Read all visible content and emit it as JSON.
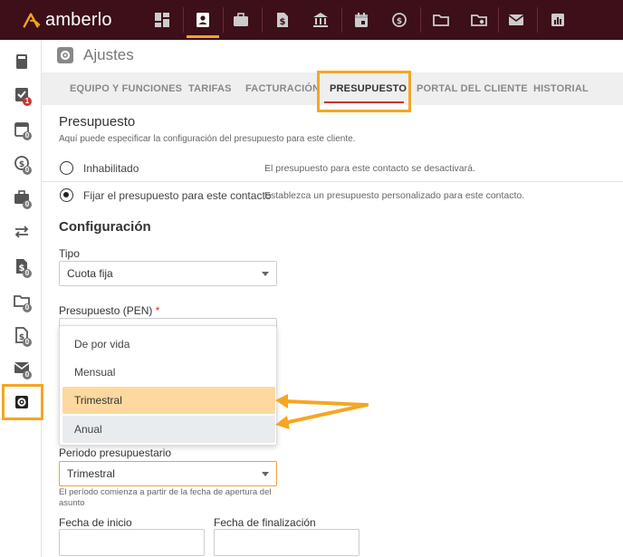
{
  "app": {
    "name": "amberlo",
    "accent": "#f5a623",
    "topbar_color": "#3d0f18"
  },
  "topnav": [
    {
      "icon": "dashboard-icon"
    },
    {
      "icon": "contact-card-icon",
      "active": true
    },
    {
      "icon": "briefcase-icon"
    },
    {
      "icon": "invoice-dollar-icon"
    },
    {
      "icon": "bank-icon"
    },
    {
      "icon": "calendar-icon"
    },
    {
      "icon": "time-money-icon"
    },
    {
      "icon": "folder-icon"
    },
    {
      "icon": "folder-settings-icon"
    },
    {
      "icon": "mail-icon"
    },
    {
      "icon": "reports-icon"
    }
  ],
  "sidebar": [
    {
      "icon": "book-icon"
    },
    {
      "icon": "task-check-icon",
      "badge": "1"
    },
    {
      "icon": "calendar-icon",
      "badge": "0"
    },
    {
      "icon": "time-money-icon",
      "badge": "0"
    },
    {
      "icon": "briefcase-icon",
      "badge": "0"
    },
    {
      "icon": "transfer-icon"
    },
    {
      "icon": "invoice-dollar-icon",
      "badge": "0"
    },
    {
      "icon": "folder-icon",
      "badge": "0"
    },
    {
      "icon": "document-money-icon",
      "badge": "0"
    },
    {
      "icon": "mail-icon",
      "badge": "0"
    },
    {
      "icon": "settings-icon",
      "active": true
    }
  ],
  "page": {
    "title": "Ajustes"
  },
  "tabs": [
    {
      "label": "EQUIPO Y FUNCIONES"
    },
    {
      "label": "TARIFAS"
    },
    {
      "label": "FACTURACIÓN"
    },
    {
      "label": "PRESUPUESTO",
      "active": true
    },
    {
      "label": "PORTAL DEL CLIENTE"
    },
    {
      "label": "HISTORIAL"
    }
  ],
  "budget": {
    "title": "Presupuesto",
    "subtitle": "Aquí puede especificar la configuración del presupuesto para este cliente.",
    "options": [
      {
        "label": "Inhabilitado",
        "description": "El presupuesto para este contacto se desactivará.",
        "checked": false
      },
      {
        "label": "Fijar el presupuesto para este contacto",
        "description": "Establezca un presupuesto personalizado para este contacto.",
        "checked": true
      }
    ]
  },
  "config": {
    "title": "Configuración",
    "type_label": "Tipo",
    "type_value": "Cuota fija",
    "budget_label": "Presupuesto (PEN)",
    "budget_required": "*",
    "dropdown_options": [
      {
        "label": "De por vida"
      },
      {
        "label": "Mensual"
      },
      {
        "label": "Trimestral",
        "selected": true
      },
      {
        "label": "Anual",
        "hover": true
      }
    ],
    "period_label": "Periodo presupuestario",
    "period_value": "Trimestral",
    "period_helper": "El período comienza a partir de la fecha de apertura del asunto",
    "start_label": "Fecha de inicio",
    "end_label": "Fecha de finalización",
    "start_value": "",
    "end_value": ""
  }
}
